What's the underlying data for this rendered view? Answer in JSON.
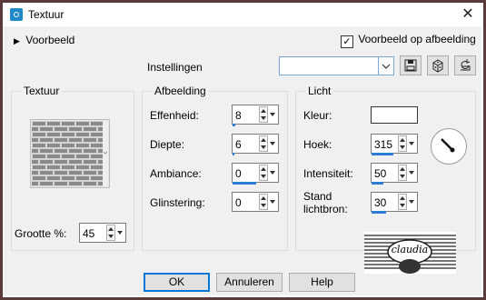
{
  "window": {
    "title": "Textuur"
  },
  "header": {
    "preview_toggle": "Voorbeeld",
    "preview_on_image": "Voorbeeld op afbeelding",
    "preview_on_image_checked": true,
    "settings_label": "Instellingen",
    "settings_value": ""
  },
  "texture": {
    "title": "Textuur",
    "size_label": "Grootte %:",
    "size_value": "45"
  },
  "image": {
    "title": "Afbeelding",
    "fields": [
      {
        "label": "Effenheid:",
        "value": "8",
        "level": 0.08
      },
      {
        "label": "Diepte:",
        "value": "6",
        "level": 0.06
      },
      {
        "label": "Ambiance:",
        "value": "0",
        "level": 1.0
      },
      {
        "label": "Glinstering:",
        "value": "0",
        "level": 0.0
      }
    ]
  },
  "light": {
    "title": "Licht",
    "color_label": "Kleur:",
    "color": "#ffffff",
    "angle_label": "Hoek:",
    "angle_value": "315",
    "intensity_label": "Intensiteit:",
    "intensity_value": "50",
    "position_label": "Stand lichtbron:",
    "position_value": "30"
  },
  "watermark": {
    "text": "claudia"
  },
  "buttons": {
    "ok": "OK",
    "cancel": "Annuleren",
    "help": "Help"
  }
}
